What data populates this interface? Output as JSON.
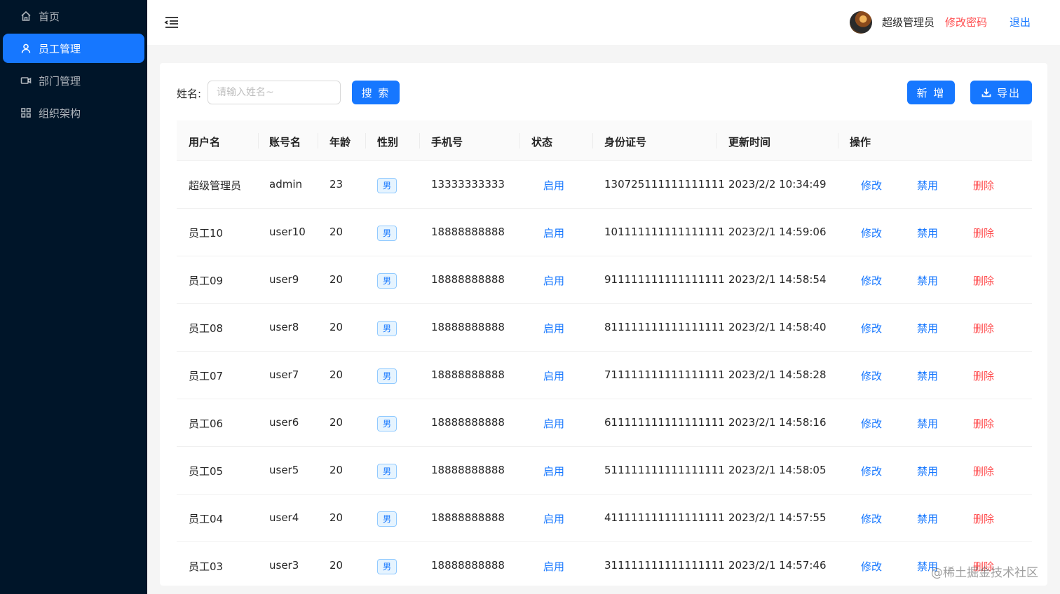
{
  "sidebar": {
    "items": [
      {
        "label": "首页",
        "icon": "home-icon",
        "active": false
      },
      {
        "label": "员工管理",
        "icon": "user-icon",
        "active": true
      },
      {
        "label": "部门管理",
        "icon": "video-icon",
        "active": false
      },
      {
        "label": "组织架构",
        "icon": "cluster-icon",
        "active": false
      }
    ]
  },
  "header": {
    "username": "超级管理员",
    "change_password": "修改密码",
    "logout": "退出"
  },
  "search": {
    "label": "姓名:",
    "placeholder": "请输入姓名~",
    "value": "",
    "button": "搜 索"
  },
  "toolbar": {
    "add_label": "新 增",
    "export_label": "导出"
  },
  "table": {
    "columns": [
      "用户名",
      "账号名",
      "年龄",
      "性别",
      "手机号",
      "状态",
      "身份证号",
      "更新时间",
      "操作"
    ],
    "rows": [
      {
        "name": "超级管理员",
        "account": "admin",
        "age": "23",
        "gender": "男",
        "phone": "13333333333",
        "status": "启用",
        "id_card": "130725111111111111",
        "updated": "2023/2/2 10:34:49",
        "edit": "修改",
        "disable": "禁用",
        "delete": "删除"
      },
      {
        "name": "员工10",
        "account": "user10",
        "age": "20",
        "gender": "男",
        "phone": "18888888888",
        "status": "启用",
        "id_card": "101111111111111111",
        "updated": "2023/2/1 14:59:06",
        "edit": "修改",
        "disable": "禁用",
        "delete": "删除"
      },
      {
        "name": "员工09",
        "account": "user9",
        "age": "20",
        "gender": "男",
        "phone": "18888888888",
        "status": "启用",
        "id_card": "911111111111111111",
        "updated": "2023/2/1 14:58:54",
        "edit": "修改",
        "disable": "禁用",
        "delete": "删除"
      },
      {
        "name": "员工08",
        "account": "user8",
        "age": "20",
        "gender": "男",
        "phone": "18888888888",
        "status": "启用",
        "id_card": "811111111111111111",
        "updated": "2023/2/1 14:58:40",
        "edit": "修改",
        "disable": "禁用",
        "delete": "删除"
      },
      {
        "name": "员工07",
        "account": "user7",
        "age": "20",
        "gender": "男",
        "phone": "18888888888",
        "status": "启用",
        "id_card": "711111111111111111",
        "updated": "2023/2/1 14:58:28",
        "edit": "修改",
        "disable": "禁用",
        "delete": "删除"
      },
      {
        "name": "员工06",
        "account": "user6",
        "age": "20",
        "gender": "男",
        "phone": "18888888888",
        "status": "启用",
        "id_card": "611111111111111111",
        "updated": "2023/2/1 14:58:16",
        "edit": "修改",
        "disable": "禁用",
        "delete": "删除"
      },
      {
        "name": "员工05",
        "account": "user5",
        "age": "20",
        "gender": "男",
        "phone": "18888888888",
        "status": "启用",
        "id_card": "511111111111111111",
        "updated": "2023/2/1 14:58:05",
        "edit": "修改",
        "disable": "禁用",
        "delete": "删除"
      },
      {
        "name": "员工04",
        "account": "user4",
        "age": "20",
        "gender": "男",
        "phone": "18888888888",
        "status": "启用",
        "id_card": "411111111111111111",
        "updated": "2023/2/1 14:57:55",
        "edit": "修改",
        "disable": "禁用",
        "delete": "删除"
      },
      {
        "name": "员工03",
        "account": "user3",
        "age": "20",
        "gender": "男",
        "phone": "18888888888",
        "status": "启用",
        "id_card": "311111111111111111",
        "updated": "2023/2/1 14:57:46",
        "edit": "修改",
        "disable": "禁用",
        "delete": "删除"
      }
    ]
  },
  "watermark": "@稀土掘金技术社区",
  "colors": {
    "sidebar_bg": "#001529",
    "primary": "#1677ff",
    "danger": "#ff4d4f"
  }
}
